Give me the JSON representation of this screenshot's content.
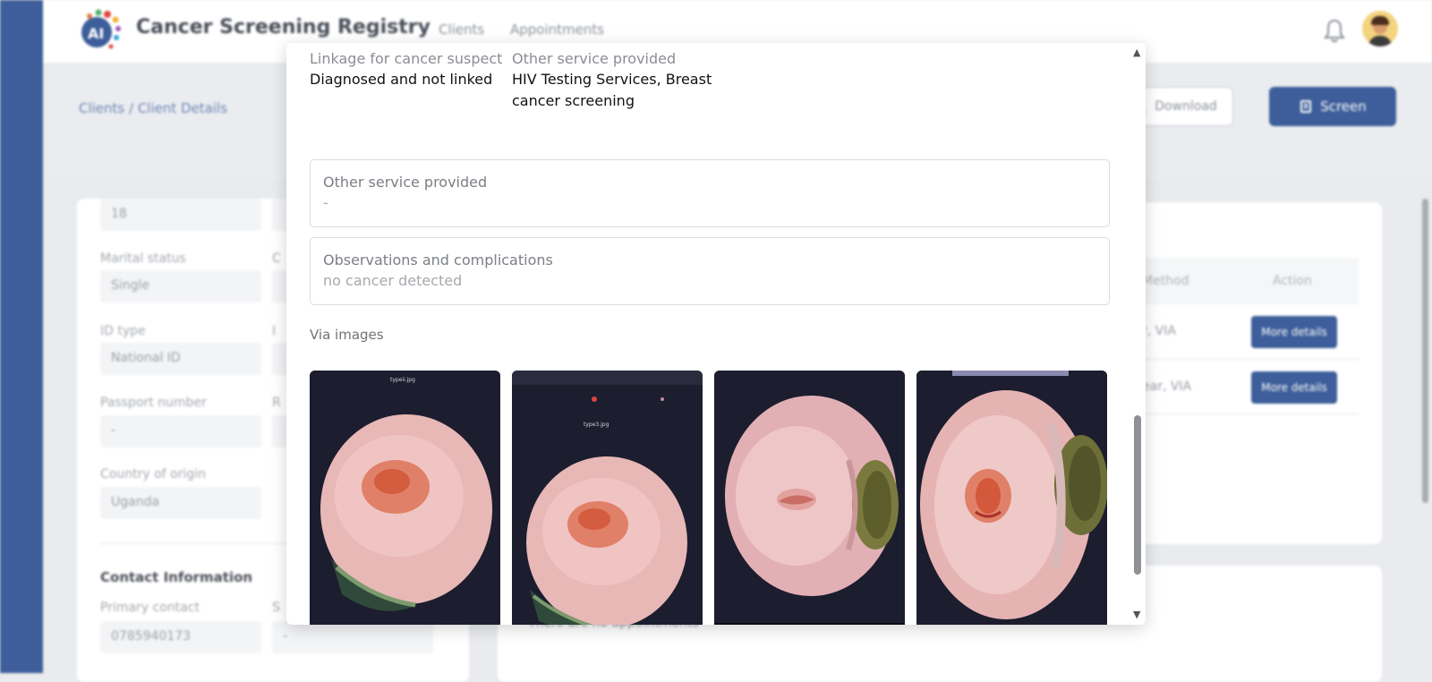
{
  "app": {
    "title": "Cancer Screening Registry",
    "nav": [
      "Clients",
      "Appointments"
    ],
    "breadcrumb": "Clients / Client Details",
    "download_label": "Download",
    "screen_label": "Screen"
  },
  "client": {
    "age_value": "18",
    "marital_status": {
      "label": "Marital status",
      "value": "Single"
    },
    "id_type": {
      "label": "ID type",
      "value": "National ID"
    },
    "passport": {
      "label": "Passport number",
      "value": "-"
    },
    "country": {
      "label": "Country of origin",
      "value": "Uganda"
    },
    "contact_title": "Contact Information",
    "primary_contact": {
      "label": "Primary contact",
      "value": "0785940173"
    },
    "secondary_contact_value": "-",
    "truncated_labels": {
      "col2_row1": "C",
      "col2_row2": "I",
      "col2_row3": "R",
      "col2_row4": "S"
    }
  },
  "screenings": {
    "headers": {
      "method": "Method",
      "action": "Action"
    },
    "rows": [
      {
        "method": "r, VIA",
        "action": "More details"
      },
      {
        "method": "ear, VIA",
        "action": "More details"
      }
    ],
    "no_appointments": "There are no appointments"
  },
  "modal": {
    "linkage": {
      "label": "Linkage for cancer suspect",
      "value": "Diagnosed and not linked"
    },
    "other_service_top": {
      "label": "Other service provided",
      "value_line1": "HIV Testing Services, Breast",
      "value_line2": "cancer screening"
    },
    "other_service_box": {
      "label": "Other service provided",
      "value": "-"
    },
    "observations": {
      "label": "Observations and complications",
      "value": "no cancer detected"
    },
    "via_images_label": "Via images",
    "images": [
      "via-image-1",
      "via-image-2",
      "via-image-3",
      "via-image-4"
    ],
    "image_captions": {
      "img1_top": "typeii.jpg",
      "img2_top": "type3.jpg"
    }
  },
  "colors": {
    "primary": "#3d5e9a",
    "sidebar": "#3d5e9a",
    "modal_bg": "#ffffff"
  }
}
